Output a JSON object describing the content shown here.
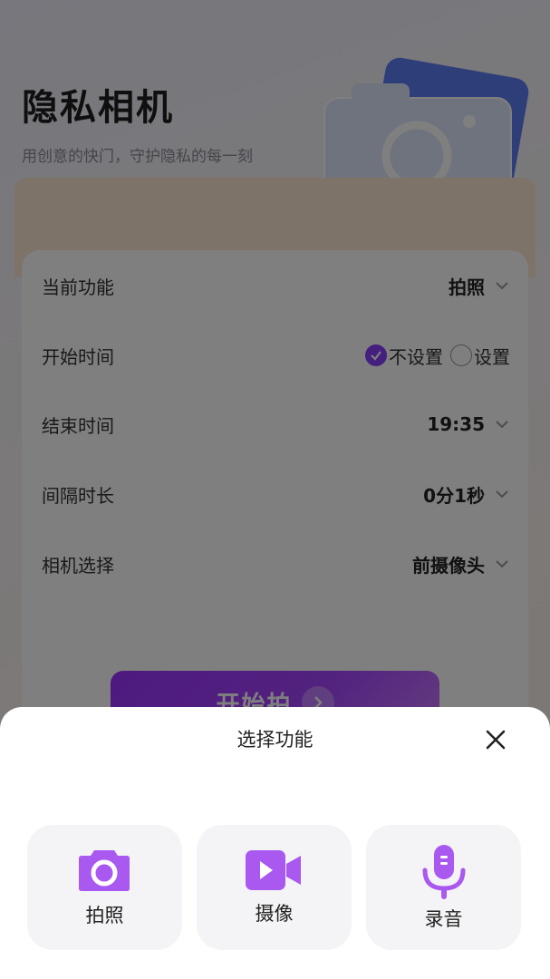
{
  "header": {
    "title": "隐私相机",
    "subtitle": "用创意的快门，守护隐私的每一刻"
  },
  "settings": {
    "current_function": {
      "label": "当前功能",
      "value": "拍照"
    },
    "start_time": {
      "label": "开始时间",
      "options": [
        "不设置",
        "设置"
      ],
      "selected": "不设置"
    },
    "end_time": {
      "label": "结束时间",
      "value": "19:35"
    },
    "interval": {
      "label": "间隔时长",
      "value": "0分1秒"
    },
    "camera": {
      "label": "相机选择",
      "value": "前摄像头"
    }
  },
  "start_button": {
    "label": "开始拍"
  },
  "sheet": {
    "title": "选择功能",
    "options": [
      {
        "label": "拍照",
        "icon": "camera-icon"
      },
      {
        "label": "摄像",
        "icon": "video-camera-icon"
      },
      {
        "label": "录音",
        "icon": "microphone-icon"
      }
    ]
  },
  "colors": {
    "accent": "#8a3ffc",
    "icon_purple": "#a958f0",
    "overlay": "rgba(0,0,0,0.5)"
  }
}
